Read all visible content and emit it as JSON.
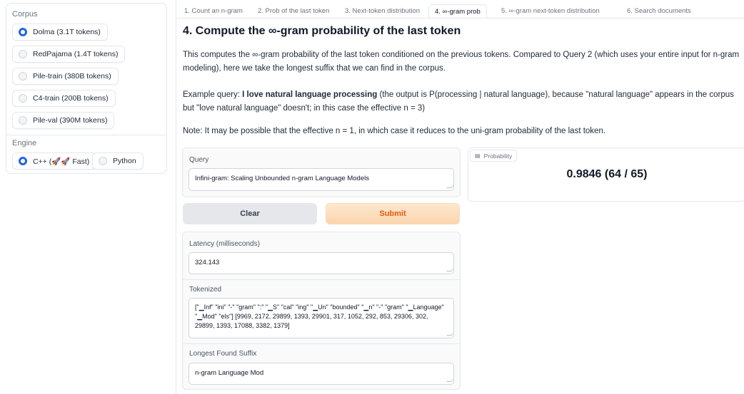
{
  "sidebar": {
    "corpus_label": "Corpus",
    "corpus_options": [
      {
        "label": "Dolma (3.1T tokens)",
        "selected": true
      },
      {
        "label": "RedPajama (1.4T tokens)",
        "selected": false
      },
      {
        "label": "Pile-train (380B tokens)",
        "selected": false
      },
      {
        "label": "C4-train (200B tokens)",
        "selected": false
      },
      {
        "label": "Pile-val (390M tokens)",
        "selected": false
      }
    ],
    "engine_label": "Engine",
    "engine_options": [
      {
        "label": "C++ (🚀🚀 Fast)",
        "selected": true
      },
      {
        "label": "Python",
        "selected": false
      }
    ]
  },
  "tabs": [
    {
      "label": "1. Count an n-gram",
      "active": false
    },
    {
      "label": "2. Prob of the last token",
      "active": false
    },
    {
      "label": "3. Next-token distribution",
      "active": false
    },
    {
      "label": "4. ∞-gram prob",
      "active": true
    },
    {
      "label": "5. ∞-gram next-token distribution",
      "active": false
    },
    {
      "label": "6. Search documents",
      "active": false
    }
  ],
  "main": {
    "heading": "4. Compute the ∞-gram probability of the last token",
    "description": "This computes the ∞-gram probability of the last token conditioned on the previous tokens. Compared to Query 2 (which uses your entire input for n-gram modeling), here we take the longest suffix that we can find in the corpus.",
    "example_prefix": "Example query: ",
    "example_query": "I love natural language processing",
    "example_suffix": " (the output is P(processing | natural language), because \"natural language\" appears in the corpus but \"love natural language\" doesn't; in this case the effective n = 3)",
    "note": "Note: It may be possible that the effective n = 1, in which case it reduces to the uni-gram probability of the last token.",
    "query_label": "Query",
    "query_value": "Infini-gram: Scaling Unbounded n-gram Language Models",
    "clear_label": "Clear",
    "submit_label": "Submit",
    "latency_label": "Latency (milliseconds)",
    "latency_value": "324.143",
    "tokenized_label": "Tokenized",
    "tokenized_value": "[\"▁Inf\" \"ini\" \"-\" \"gram\" \":\" \"▁S\" \"cal\" \"ing\" \"▁Un\" \"bounded\" \"▁n\" \"-\" \"gram\" \"▁Language\" \"▁Mod\" \"els\"] [9969, 2172, 29899, 1393, 29901, 317, 1052, 292, 853, 29306, 302, 29899, 1393, 17088, 3382, 1379]",
    "suffix_label": "Longest Found Suffix",
    "suffix_value": "n-gram Language Mod",
    "probability_tag": "Probability",
    "probability_value": "0.9846 (64 / 65)"
  }
}
